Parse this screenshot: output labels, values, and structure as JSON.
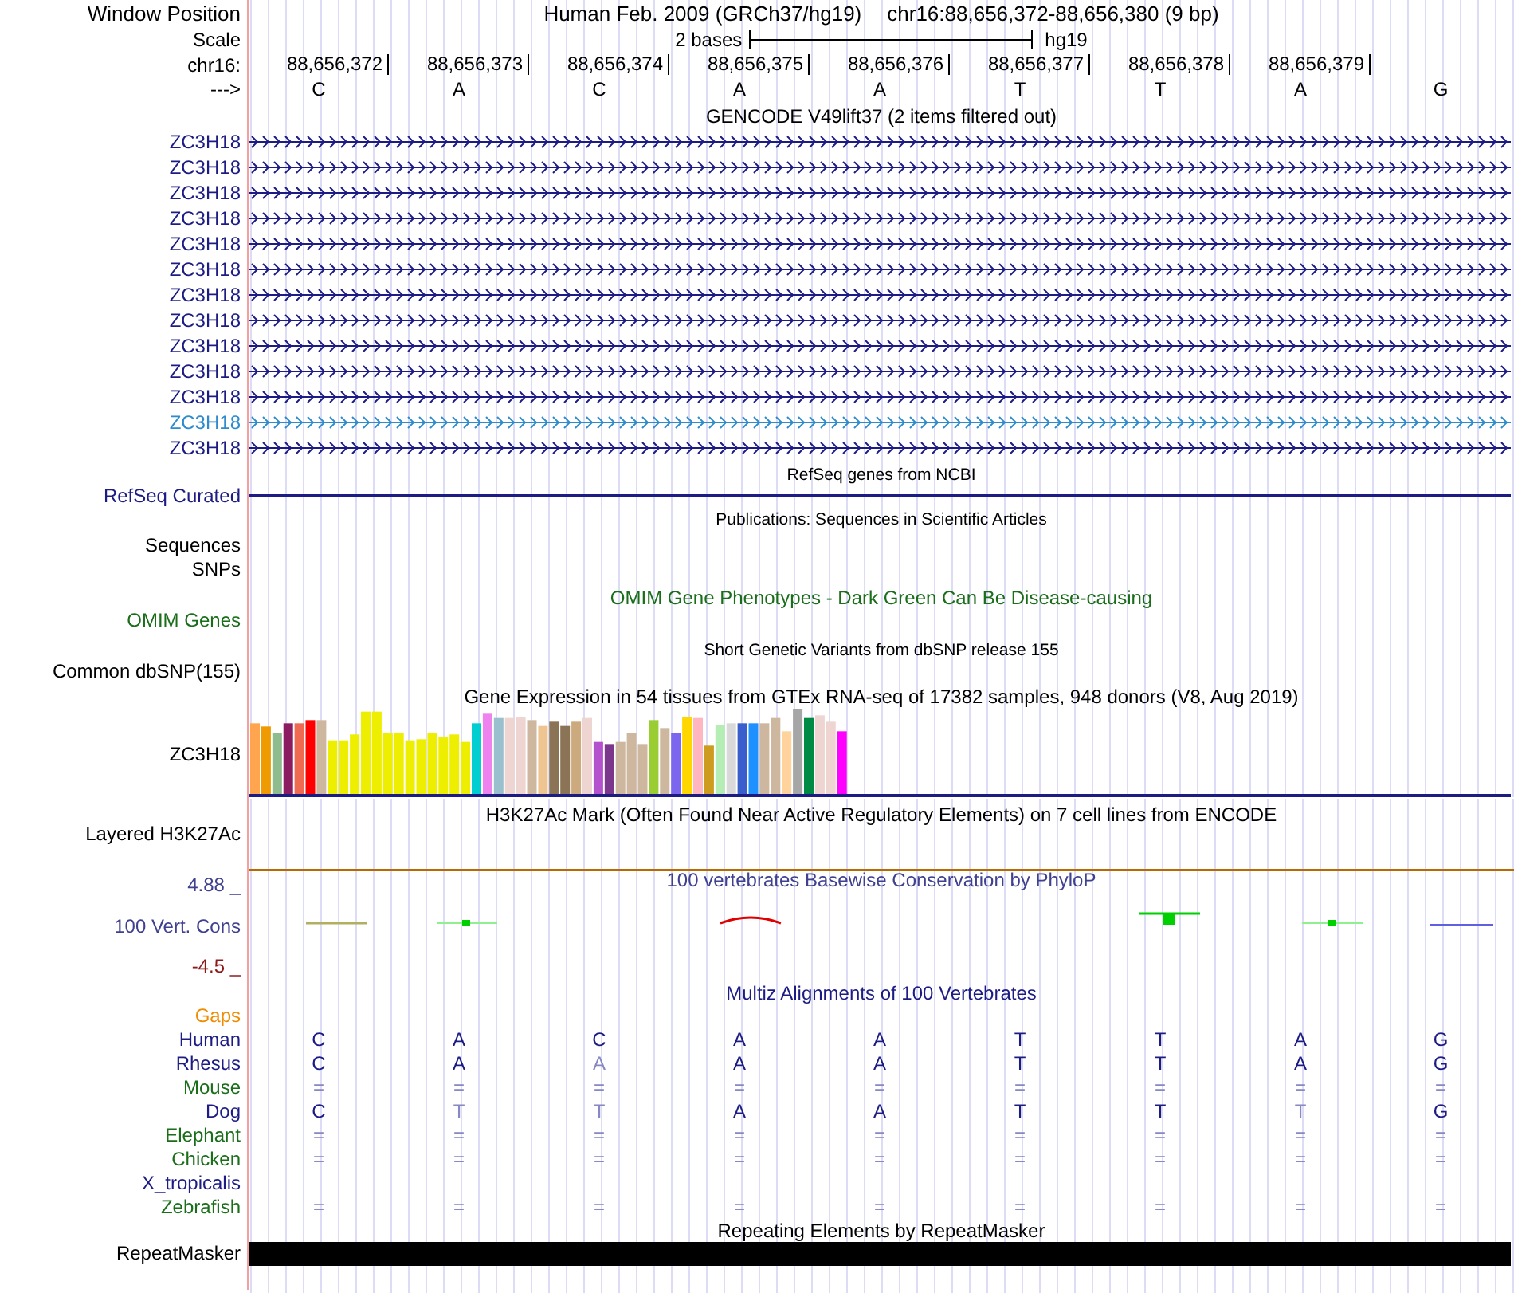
{
  "header": {
    "label": "Window Position",
    "assembly_title": "Human Feb. 2009 (GRCh37/hg19)",
    "position_title": "chr16:88,656,372-88,656,380 (9 bp)"
  },
  "scale": {
    "label": "Scale",
    "span": "2 bases",
    "assembly": "hg19"
  },
  "ruler": {
    "label": "chr16:",
    "positions": [
      "88,656,372",
      "88,656,373",
      "88,656,374",
      "88,656,375",
      "88,656,376",
      "88,656,377",
      "88,656,378",
      "88,656,379"
    ]
  },
  "sequence": {
    "label": "--->",
    "bases": [
      "C",
      "A",
      "C",
      "A",
      "A",
      "T",
      "T",
      "A",
      "G"
    ]
  },
  "gencode": {
    "title": "GENCODE V49lift37 (2 items filtered out)",
    "items": [
      {
        "label": "ZC3H18",
        "color": "#1c1c84"
      },
      {
        "label": "ZC3H18",
        "color": "#1c1c84"
      },
      {
        "label": "ZC3H18",
        "color": "#1c1c84"
      },
      {
        "label": "ZC3H18",
        "color": "#1c1c84"
      },
      {
        "label": "ZC3H18",
        "color": "#1c1c84"
      },
      {
        "label": "ZC3H18",
        "color": "#1c1c84"
      },
      {
        "label": "ZC3H18",
        "color": "#1c1c84"
      },
      {
        "label": "ZC3H18",
        "color": "#1c1c84"
      },
      {
        "label": "ZC3H18",
        "color": "#1c1c84"
      },
      {
        "label": "ZC3H18",
        "color": "#1c1c84"
      },
      {
        "label": "ZC3H18",
        "color": "#1c1c84"
      },
      {
        "label": "ZC3H18",
        "color": "#2f8ccc"
      },
      {
        "label": "ZC3H18",
        "color": "#1c1c84"
      }
    ]
  },
  "refseq": {
    "title": "RefSeq genes from NCBI",
    "label": "RefSeq Curated"
  },
  "publications": {
    "title": "Publications: Sequences in Scientific Articles",
    "label_lines": [
      "Sequences",
      "SNPs"
    ]
  },
  "omim": {
    "title": "OMIM Gene Phenotypes - Dark Green Can Be Disease-causing",
    "label": "OMIM Genes"
  },
  "dbsnp": {
    "title": "Short Genetic Variants from dbSNP release 155",
    "label": "Common dbSNP(155)"
  },
  "gtex": {
    "title": "Gene Expression in 54 tissues from GTEx RNA-seq of 17382 samples, 948 donors (V8, Aug 2019)",
    "label": "ZC3H18"
  },
  "h3k27ac": {
    "title": "H3K27Ac Mark (Often Found Near Active Regulatory Elements) on 7 cell lines from ENCODE",
    "label": "Layered H3K27Ac"
  },
  "conservation": {
    "title": "100 vertebrates Basewise Conservation by PhyloP",
    "label": "100 Vert. Cons",
    "max_label": "4.88 _",
    "min_label": "-4.5 _"
  },
  "multiz": {
    "title": "Multiz Alignments of 100 Vertebrates",
    "gaps_label": "Gaps",
    "species": [
      {
        "name": "Human",
        "color": "#1c1c84",
        "bases": [
          {
            "text": "C",
            "faded": false
          },
          {
            "text": "A",
            "faded": false
          },
          {
            "text": "C",
            "faded": false
          },
          {
            "text": "A",
            "faded": false
          },
          {
            "text": "A",
            "faded": false
          },
          {
            "text": "T",
            "faded": false
          },
          {
            "text": "T",
            "faded": false
          },
          {
            "text": "A",
            "faded": false
          },
          {
            "text": "G",
            "faded": false
          }
        ]
      },
      {
        "name": "Rhesus",
        "color": "#1c1c84",
        "bases": [
          {
            "text": "C",
            "faded": false
          },
          {
            "text": "A",
            "faded": false
          },
          {
            "text": "A",
            "faded": true
          },
          {
            "text": "A",
            "faded": false
          },
          {
            "text": "A",
            "faded": false
          },
          {
            "text": "T",
            "faded": false
          },
          {
            "text": "T",
            "faded": false
          },
          {
            "text": "A",
            "faded": false
          },
          {
            "text": "G",
            "faded": false
          }
        ]
      },
      {
        "name": "Mouse",
        "color": "#1a6e1a",
        "bases": [
          {
            "text": "=",
            "faded": true
          },
          {
            "text": "=",
            "faded": true
          },
          {
            "text": "=",
            "faded": true
          },
          {
            "text": "=",
            "faded": true
          },
          {
            "text": "=",
            "faded": true
          },
          {
            "text": "=",
            "faded": true
          },
          {
            "text": "=",
            "faded": true
          },
          {
            "text": "=",
            "faded": true
          },
          {
            "text": "=",
            "faded": true
          }
        ]
      },
      {
        "name": "Dog",
        "color": "#1c1c84",
        "bases": [
          {
            "text": "C",
            "faded": false
          },
          {
            "text": "T",
            "faded": true
          },
          {
            "text": "T",
            "faded": true
          },
          {
            "text": "A",
            "faded": false
          },
          {
            "text": "A",
            "faded": false
          },
          {
            "text": "T",
            "faded": false
          },
          {
            "text": "T",
            "faded": false
          },
          {
            "text": "T",
            "faded": true
          },
          {
            "text": "G",
            "faded": false
          }
        ]
      },
      {
        "name": "Elephant",
        "color": "#1a6e1a",
        "bases": [
          {
            "text": "=",
            "faded": true
          },
          {
            "text": "=",
            "faded": true
          },
          {
            "text": "=",
            "faded": true
          },
          {
            "text": "=",
            "faded": true
          },
          {
            "text": "=",
            "faded": true
          },
          {
            "text": "=",
            "faded": true
          },
          {
            "text": "=",
            "faded": true
          },
          {
            "text": "=",
            "faded": true
          },
          {
            "text": "=",
            "faded": true
          }
        ]
      },
      {
        "name": "Chicken",
        "color": "#1a6e1a",
        "bases": [
          {
            "text": "=",
            "faded": true
          },
          {
            "text": "=",
            "faded": true
          },
          {
            "text": "=",
            "faded": true
          },
          {
            "text": "=",
            "faded": true
          },
          {
            "text": "=",
            "faded": true
          },
          {
            "text": "=",
            "faded": true
          },
          {
            "text": "=",
            "faded": true
          },
          {
            "text": "=",
            "faded": true
          },
          {
            "text": "=",
            "faded": true
          }
        ]
      },
      {
        "name": "X_tropicalis",
        "color": "#1c1c84"
      },
      {
        "name": "Zebrafish",
        "color": "#1a6e1a",
        "bases": [
          {
            "text": "=",
            "faded": true
          },
          {
            "text": "=",
            "faded": true
          },
          {
            "text": "=",
            "faded": true
          },
          {
            "text": "=",
            "faded": true
          },
          {
            "text": "=",
            "faded": true
          },
          {
            "text": "=",
            "faded": true
          },
          {
            "text": "=",
            "faded": true
          },
          {
            "text": "=",
            "faded": true
          },
          {
            "text": "=",
            "faded": true
          }
        ]
      }
    ]
  },
  "repeatmasker": {
    "title": "Repeating Elements by RepeatMasker",
    "label": "RepeatMasker"
  }
}
